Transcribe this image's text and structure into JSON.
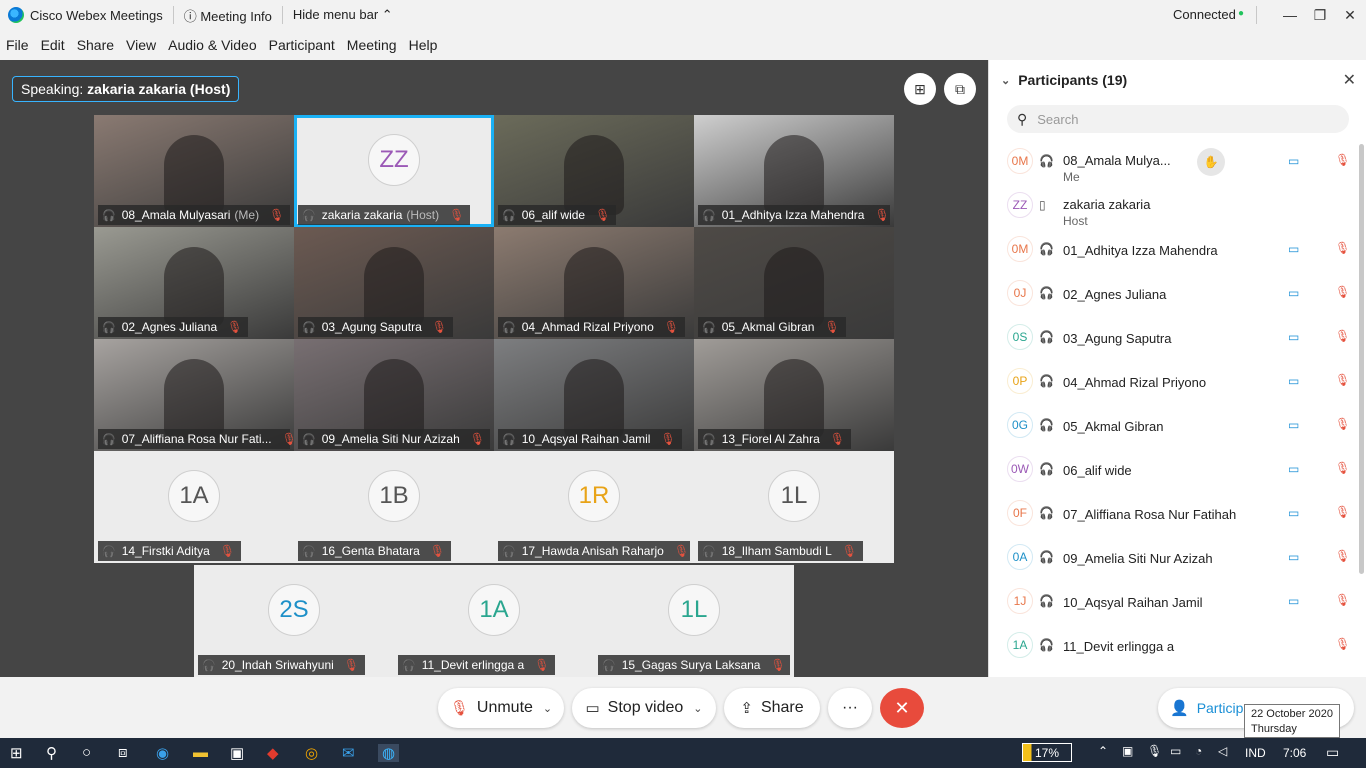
{
  "window": {
    "app_title": "Cisco Webex Meetings",
    "meeting_info": "Meeting Info",
    "hide_menu": "Hide menu bar",
    "status": "Connected",
    "status_color": "#21c35c"
  },
  "menu": [
    "File",
    "Edit",
    "Share",
    "View",
    "Audio & Video",
    "Participant",
    "Meeting",
    "Help"
  ],
  "speaking": {
    "prefix": "Speaking:",
    "name": "zakaria zakaria (Host)"
  },
  "tiles": [
    {
      "name": "08_Amala Mulyasari",
      "suffix": "(Me)",
      "video": true
    },
    {
      "name": "zakaria zakaria",
      "suffix": "(Host)",
      "video": false,
      "initials": "ZZ",
      "color": "#9b59b6",
      "active": true
    },
    {
      "name": "06_alif wide",
      "video": true
    },
    {
      "name": "01_Adhitya Izza Mahendra",
      "video": true
    },
    {
      "name": "02_Agnes Juliana",
      "video": true
    },
    {
      "name": "03_Agung Saputra",
      "video": true
    },
    {
      "name": "04_Ahmad Rizal Priyono",
      "video": true
    },
    {
      "name": "05_Akmal Gibran",
      "video": true
    },
    {
      "name": "07_Aliffiana Rosa Nur Fati...",
      "video": true
    },
    {
      "name": "09_Amelia Siti Nur Azizah",
      "video": true
    },
    {
      "name": "10_Aqsyal Raihan Jamil",
      "video": true
    },
    {
      "name": "13_Fiorel Al Zahra",
      "video": true
    },
    {
      "name": "14_Firstki Aditya",
      "video": false,
      "initials": "1A",
      "color": "#555555"
    },
    {
      "name": "16_Genta Bhatara",
      "video": false,
      "initials": "1B",
      "color": "#555555"
    },
    {
      "name": "17_Hawda Anisah Raharjo",
      "video": false,
      "initials": "1R",
      "color": "#e8a317"
    },
    {
      "name": "18_Ilham Sambudi L",
      "video": false,
      "initials": "1L",
      "color": "#555555"
    },
    {
      "name": "20_Indah Sriwahyuni",
      "video": false,
      "initials": "2S",
      "color": "#1e90c8"
    },
    {
      "name": "11_Devit erlingga a",
      "video": false,
      "initials": "1A",
      "color": "#2aa68f"
    },
    {
      "name": "15_Gagas Surya Laksana",
      "video": false,
      "initials": "1L",
      "color": "#2aa68f"
    }
  ],
  "panel": {
    "title": "Participants (19)",
    "search_placeholder": "Search",
    "rows": [
      {
        "initials": "0M",
        "color": "#e8764a",
        "name": "08_Amala Mulya...",
        "sub": "Me",
        "cam": true,
        "hand": true
      },
      {
        "initials": "ZZ",
        "color": "#9b59b6",
        "name": "zakaria zakaria",
        "sub": "Host",
        "cam": false
      },
      {
        "initials": "0M",
        "color": "#e8764a",
        "name": "01_Adhitya Izza Mahendra",
        "cam": true
      },
      {
        "initials": "0J",
        "color": "#e8764a",
        "name": "02_Agnes Juliana",
        "cam": true
      },
      {
        "initials": "0S",
        "color": "#2aa68f",
        "name": "03_Agung Saputra",
        "cam": true
      },
      {
        "initials": "0P",
        "color": "#e8a317",
        "name": "04_Ahmad Rizal Priyono",
        "cam": true
      },
      {
        "initials": "0G",
        "color": "#1e90c8",
        "name": "05_Akmal Gibran",
        "cam": true
      },
      {
        "initials": "0W",
        "color": "#9b59b6",
        "name": "06_alif wide",
        "cam": true
      },
      {
        "initials": "0F",
        "color": "#e8764a",
        "name": "07_Aliffiana Rosa Nur Fatihah",
        "cam": true
      },
      {
        "initials": "0A",
        "color": "#1e90c8",
        "name": "09_Amelia Siti Nur Azizah",
        "cam": true
      },
      {
        "initials": "1J",
        "color": "#e8764a",
        "name": "10_Aqsyal Raihan Jamil",
        "cam": true
      },
      {
        "initials": "1A",
        "color": "#2aa68f",
        "name": "11_Devit erlingga a",
        "cam": false
      }
    ]
  },
  "controls": {
    "unmute": "Unmute",
    "stop_video": "Stop video",
    "share": "Share",
    "more": "···",
    "participants": "Participa"
  },
  "tooltip": {
    "date": "22 October 2020",
    "day": "Thursday"
  },
  "taskbar": {
    "battery": "17%",
    "lang": "IND",
    "time": "7:06"
  }
}
